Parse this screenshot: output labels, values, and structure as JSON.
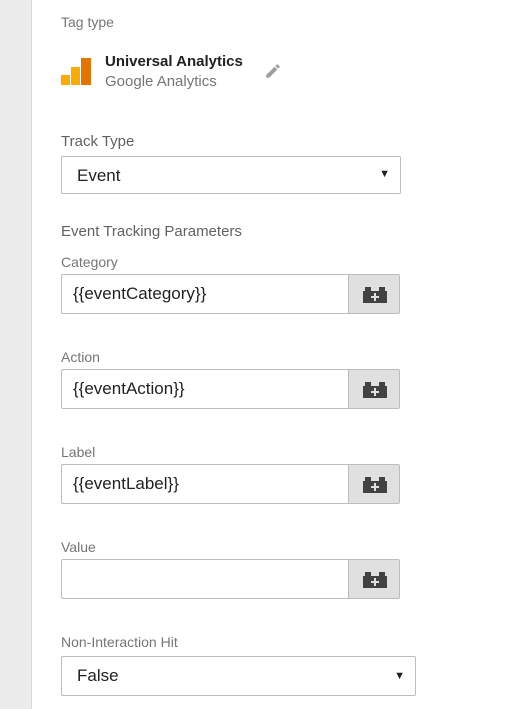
{
  "tag_type": {
    "section_label": "Tag type",
    "name": "Universal Analytics",
    "vendor": "Google Analytics",
    "logo_icon": "google-analytics-logo",
    "edit_icon": "pencil-icon"
  },
  "track_type": {
    "label": "Track Type",
    "selected": "Event"
  },
  "event_params": {
    "heading": "Event Tracking Parameters",
    "fields": [
      {
        "label": "Category",
        "value": "{{eventCategory}}"
      },
      {
        "label": "Action",
        "value": "{{eventAction}}"
      },
      {
        "label": "Label",
        "value": "{{eventLabel}}"
      },
      {
        "label": "Value",
        "value": ""
      }
    ],
    "variable_button_icon": "lego-brick-plus-icon"
  },
  "non_interaction": {
    "label": "Non-Interaction Hit",
    "selected": "False"
  },
  "colors": {
    "ga_logo_dark": "#e37400",
    "ga_logo_light": "#f9ab00",
    "button_bg": "#e0e0e0",
    "icon_dark": "#424242"
  }
}
